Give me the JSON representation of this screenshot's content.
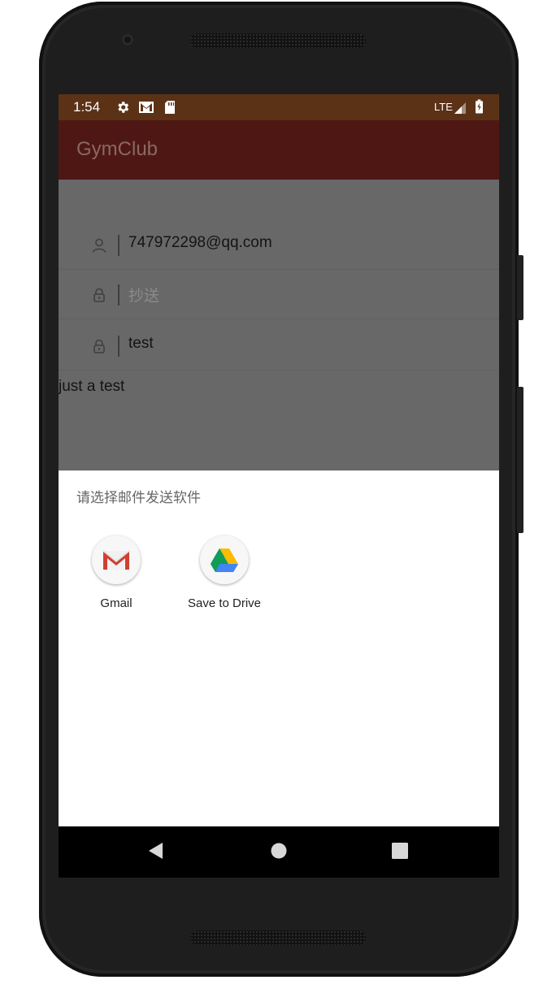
{
  "status_bar": {
    "time": "1:54",
    "network": "LTE",
    "icons": [
      "gear-icon",
      "gmail-notification-icon",
      "sd-card-icon",
      "signal-icon",
      "battery-icon"
    ]
  },
  "app_bar": {
    "title": "GymClub"
  },
  "form": {
    "to": {
      "value": "747972298@qq.com",
      "icon": "person-icon"
    },
    "cc": {
      "placeholder": "抄送",
      "icon": "lock-icon"
    },
    "subject": {
      "value": "test",
      "icon": "lock-icon"
    },
    "body": "just a test"
  },
  "share_sheet": {
    "title": "请选择邮件发送软件",
    "apps": [
      {
        "label": "Gmail",
        "icon": "gmail-icon"
      },
      {
        "label": "Save to Drive",
        "icon": "google-drive-icon"
      }
    ]
  },
  "nav_bar": {
    "buttons": [
      "back-icon",
      "home-icon",
      "recents-icon"
    ]
  },
  "colors": {
    "status_bar": "#5c3217",
    "app_bar": "#4e1714",
    "scrim_content": "#686868"
  }
}
